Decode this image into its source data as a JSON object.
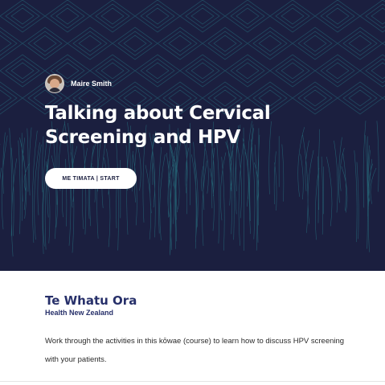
{
  "hero": {
    "author_name": "Maire Smith",
    "title": "Talking about Cervical Screening and HPV",
    "start_label": "ME TIMATA | START",
    "background_color": "#1b1f3f",
    "pattern_color": "#2ea3a8"
  },
  "content": {
    "org_name": "Te Whatu Ora",
    "org_subtitle": "Health New Zealand",
    "description": "Work through the activities in this kōwae (course) to learn how to discuss HPV screening with your patients."
  }
}
